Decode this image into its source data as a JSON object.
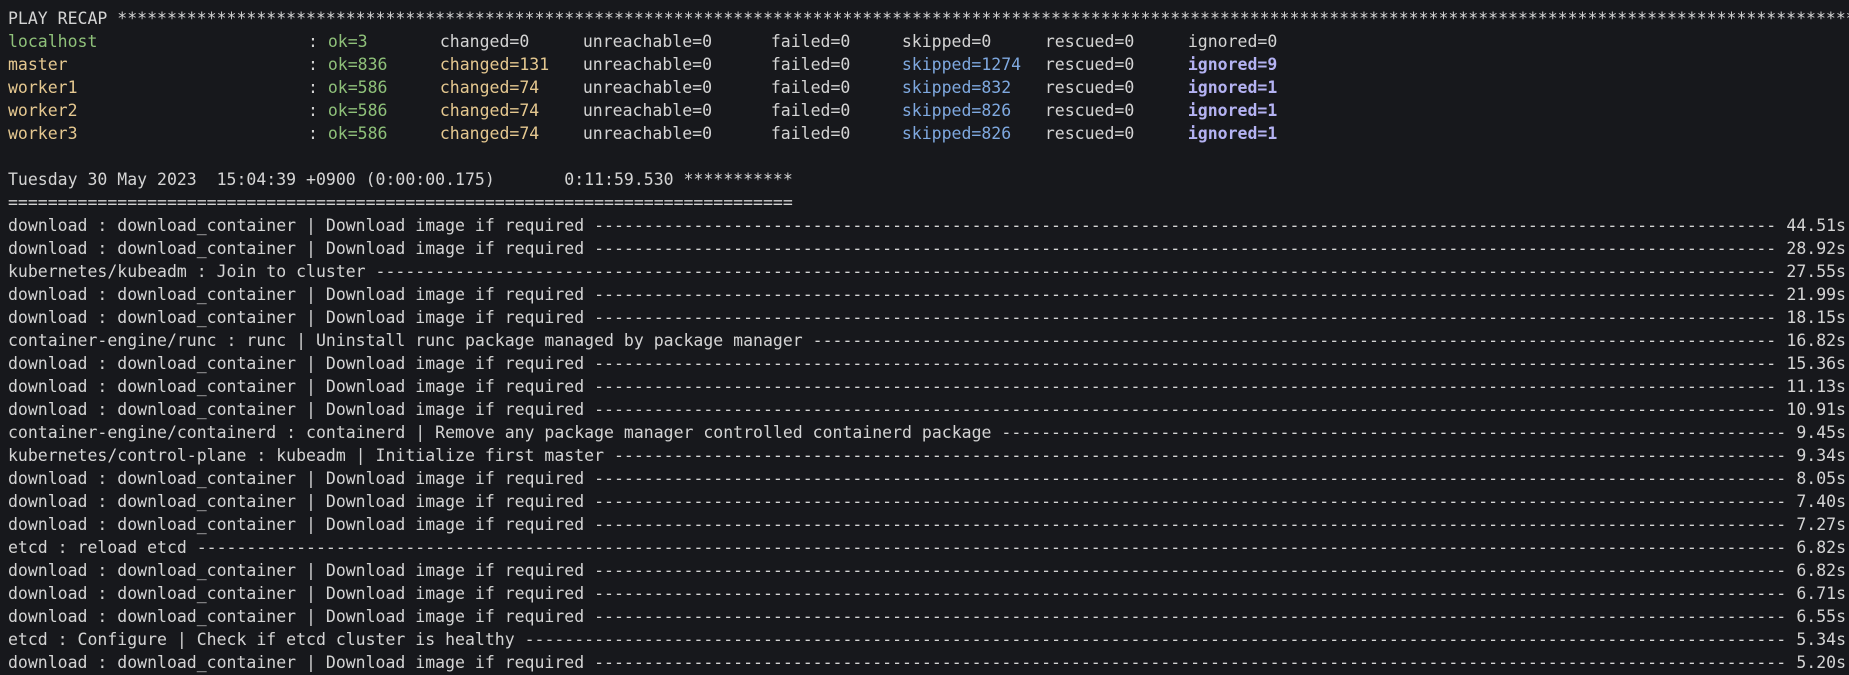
{
  "terminal": {
    "recap_header": "PLAY RECAP *****************************************************************************************************************************************************************************************************************",
    "colon": ": ",
    "hosts": [
      {
        "name": "localhost",
        "ok": "ok=3",
        "changed": "changed=0",
        "unreachable": "unreachable=0",
        "failed": "failed=0",
        "skipped": "skipped=0",
        "rescued": "rescued=0",
        "ignored": "ignored=0",
        "highlight": false
      },
      {
        "name": "master",
        "ok": "ok=836",
        "changed": "changed=131",
        "unreachable": "unreachable=0",
        "failed": "failed=0",
        "skipped": "skipped=1274",
        "rescued": "rescued=0",
        "ignored": "ignored=9",
        "highlight": true
      },
      {
        "name": "worker1",
        "ok": "ok=586",
        "changed": "changed=74",
        "unreachable": "unreachable=0",
        "failed": "failed=0",
        "skipped": "skipped=832",
        "rescued": "rescued=0",
        "ignored": "ignored=1",
        "highlight": true
      },
      {
        "name": "worker2",
        "ok": "ok=586",
        "changed": "changed=74",
        "unreachable": "unreachable=0",
        "failed": "failed=0",
        "skipped": "skipped=826",
        "rescued": "rescued=0",
        "ignored": "ignored=1",
        "highlight": true
      },
      {
        "name": "worker3",
        "ok": "ok=586",
        "changed": "changed=74",
        "unreachable": "unreachable=0",
        "failed": "failed=0",
        "skipped": "skipped=826",
        "rescued": "rescued=0",
        "ignored": "ignored=1",
        "highlight": true
      }
    ],
    "timestamp_line": "Tuesday 30 May 2023  15:04:39 +0900 (0:00:00.175)       0:11:59.530 ***********",
    "separator_line": "===============================================================================",
    "task_fill": " ----------------------------------------------------------------------------------------------------------------------------------------------------------------------------------------------------------------------------------",
    "tasks": [
      {
        "name": "download : download_container | Download image if required",
        "time": "44.51s"
      },
      {
        "name": "download : download_container | Download image if required",
        "time": "28.92s"
      },
      {
        "name": "kubernetes/kubeadm : Join to cluster",
        "time": "27.55s"
      },
      {
        "name": "download : download_container | Download image if required",
        "time": "21.99s"
      },
      {
        "name": "download : download_container | Download image if required",
        "time": "18.15s"
      },
      {
        "name": "container-engine/runc : runc | Uninstall runc package managed by package manager",
        "time": "16.82s"
      },
      {
        "name": "download : download_container | Download image if required",
        "time": "15.36s"
      },
      {
        "name": "download : download_container | Download image if required",
        "time": "11.13s"
      },
      {
        "name": "download : download_container | Download image if required",
        "time": "10.91s"
      },
      {
        "name": "container-engine/containerd : containerd | Remove any package manager controlled containerd package",
        "time": "9.45s"
      },
      {
        "name": "kubernetes/control-plane : kubeadm | Initialize first master",
        "time": "9.34s"
      },
      {
        "name": "download : download_container | Download image if required",
        "time": "8.05s"
      },
      {
        "name": "download : download_container | Download image if required",
        "time": "7.40s"
      },
      {
        "name": "download : download_container | Download image if required",
        "time": "7.27s"
      },
      {
        "name": "etcd : reload etcd",
        "time": "6.82s"
      },
      {
        "name": "download : download_container | Download image if required",
        "time": "6.82s"
      },
      {
        "name": "download : download_container | Download image if required",
        "time": "6.71s"
      },
      {
        "name": "download : download_container | Download image if required",
        "time": "6.55s"
      },
      {
        "name": "etcd : Configure | Check if etcd cluster is healthy",
        "time": "5.34s"
      },
      {
        "name": "download : download_container | Download image if required",
        "time": "5.20s"
      }
    ],
    "colors": {
      "background": "#17181c",
      "text": "#d4d4d4",
      "ok": "#8fc17a",
      "changed": "#e5c890",
      "skipped": "#7fa9e0",
      "ignored": "#b4b2f2"
    }
  }
}
